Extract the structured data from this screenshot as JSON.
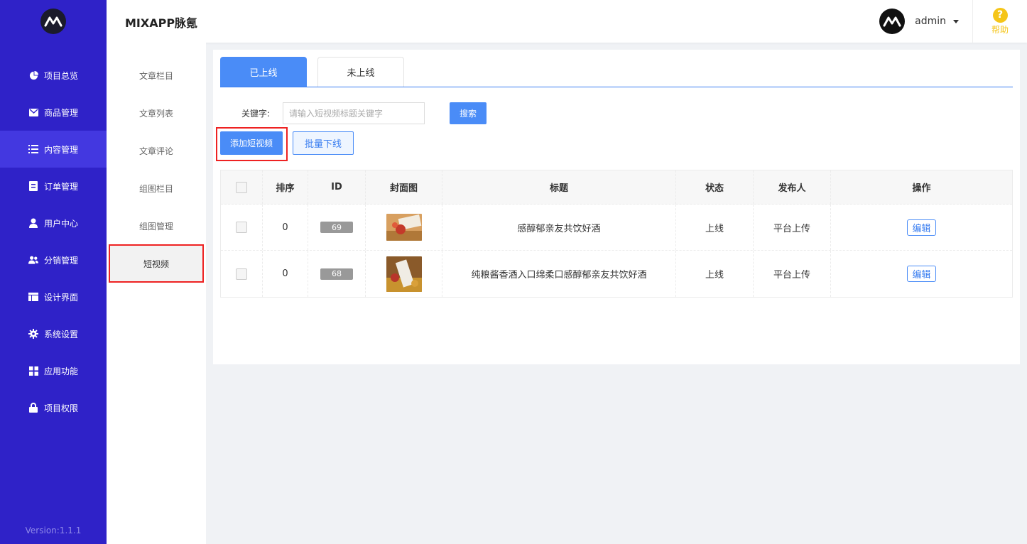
{
  "app": {
    "title": "MIXAPP脉氪",
    "version": "Version:1.1.1"
  },
  "user": {
    "name": "admin"
  },
  "help": {
    "label": "帮助"
  },
  "sidebar": {
    "items": [
      {
        "label": "项目总览",
        "icon": "pie-chart-icon"
      },
      {
        "label": "商品管理",
        "icon": "envelope-icon"
      },
      {
        "label": "内容管理",
        "icon": "list-icon"
      },
      {
        "label": "订单管理",
        "icon": "document-icon"
      },
      {
        "label": "用户中心",
        "icon": "user-icon"
      },
      {
        "label": "分销管理",
        "icon": "users-icon"
      },
      {
        "label": "设计界面",
        "icon": "layout-icon"
      },
      {
        "label": "系统设置",
        "icon": "gear-icon"
      },
      {
        "label": "应用功能",
        "icon": "grid-icon"
      },
      {
        "label": "项目权限",
        "icon": "lock-icon"
      }
    ]
  },
  "subnav": {
    "items": [
      {
        "label": "文章栏目"
      },
      {
        "label": "文章列表"
      },
      {
        "label": "文章评论"
      },
      {
        "label": "组图栏目"
      },
      {
        "label": "组图管理"
      },
      {
        "label": "短视频"
      }
    ]
  },
  "tabs": [
    {
      "label": "已上线"
    },
    {
      "label": "未上线"
    }
  ],
  "search": {
    "label": "关键字:",
    "placeholder": "请输入短视频标题关键字",
    "button": "搜索"
  },
  "actions": {
    "add": "添加短视频",
    "batch_offline": "批量下线"
  },
  "table": {
    "headers": [
      "排序",
      "ID",
      "封面图",
      "标题",
      "状态",
      "发布人",
      "操作"
    ],
    "rows": [
      {
        "sort": "0",
        "id": "69",
        "title": "感醇郁亲友共饮好酒",
        "status": "上线",
        "publisher": "平台上传",
        "action": "编辑"
      },
      {
        "sort": "0",
        "id": "68",
        "title": "纯粮酱香酒入口绵柔口感醇郁亲友共饮好酒",
        "status": "上线",
        "publisher": "平台上传",
        "action": "编辑"
      }
    ]
  },
  "colors": {
    "sidebar": "#2f22c8",
    "sidebar_active": "#4338e0",
    "primary": "#4a8cf7",
    "highlight": "#ee2222",
    "help": "#f5c518"
  }
}
